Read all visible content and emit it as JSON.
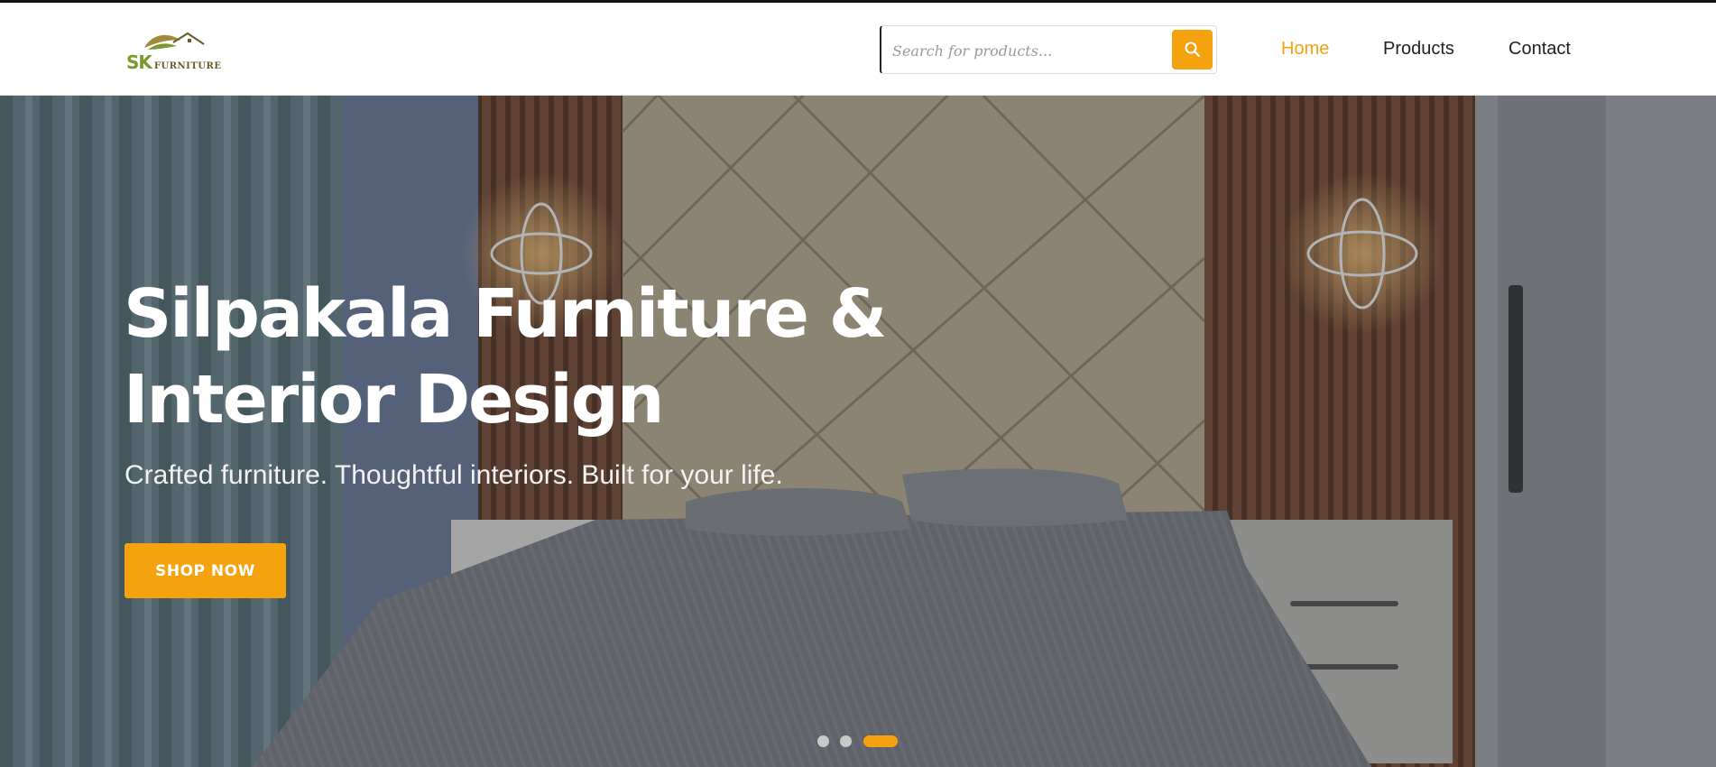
{
  "brand": {
    "logo_mark": "SK",
    "logo_word": "FURNITURE"
  },
  "search": {
    "placeholder": "Search for products...",
    "button_icon": "search-icon"
  },
  "nav": [
    {
      "label": "Home",
      "active": true
    },
    {
      "label": "Products",
      "active": false
    },
    {
      "label": "Contact",
      "active": false
    }
  ],
  "hero": {
    "title_line1": "Silpakala Furniture &",
    "title_line2": "Interior Design",
    "subtitle": "Crafted furniture. Thoughtful interiors. Built for your life.",
    "cta_label": "SHOP NOW",
    "slides_total": 3,
    "active_slide": 3
  },
  "colors": {
    "accent": "#f5a20f",
    "brand_green": "#7a9a2e",
    "text_dark": "#222222"
  }
}
